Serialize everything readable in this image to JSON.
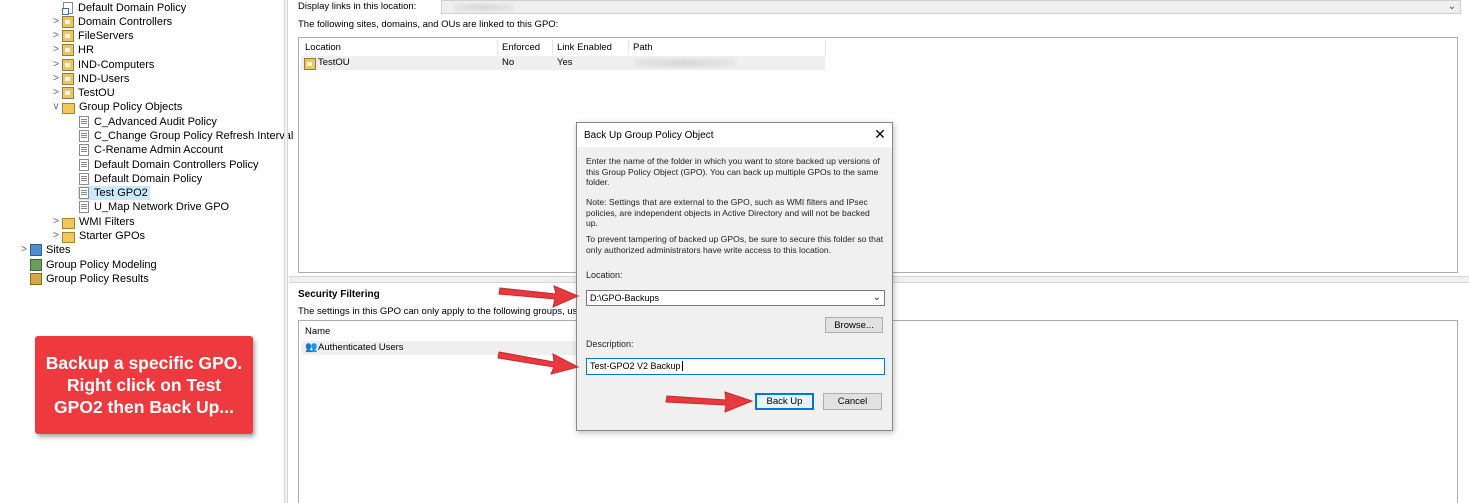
{
  "tree": {
    "items": [
      {
        "label": "Default Domain Policy",
        "icon": "linked-gpo-icon",
        "chevron": ""
      },
      {
        "label": "Domain Controllers",
        "icon": "ou-icon",
        "chevron": ">"
      },
      {
        "label": "FileServers",
        "icon": "ou-icon",
        "chevron": ">"
      },
      {
        "label": "HR",
        "icon": "ou-icon",
        "chevron": ">"
      },
      {
        "label": "IND-Computers",
        "icon": "ou-icon",
        "chevron": ">"
      },
      {
        "label": "IND-Users",
        "icon": "ou-icon",
        "chevron": ">"
      },
      {
        "label": "TestOU",
        "icon": "ou-icon",
        "chevron": ">"
      },
      {
        "label": "Group Policy Objects",
        "icon": "folder-icon",
        "chevron": "v"
      },
      {
        "label": "C_Advanced Audit Policy",
        "icon": "gpo-icon",
        "chevron": ""
      },
      {
        "label": "C_Change Group Policy Refresh Interval",
        "icon": "gpo-icon",
        "chevron": ""
      },
      {
        "label": "C-Rename Admin Account",
        "icon": "gpo-icon",
        "chevron": ""
      },
      {
        "label": "Default Domain Controllers Policy",
        "icon": "gpo-icon",
        "chevron": ""
      },
      {
        "label": "Default Domain Policy",
        "icon": "gpo-icon",
        "chevron": ""
      },
      {
        "label": "Test GPO2",
        "icon": "gpo-icon",
        "chevron": "",
        "selected": true
      },
      {
        "label": "U_Map Network Drive GPO",
        "icon": "gpo-icon",
        "chevron": ""
      },
      {
        "label": "WMI Filters",
        "icon": "folder-icon",
        "chevron": ">"
      },
      {
        "label": "Starter GPOs",
        "icon": "folder-icon",
        "chevron": ">"
      },
      {
        "label": "Sites",
        "icon": "sites-icon",
        "chevron": ">"
      },
      {
        "label": "Group Policy Modeling",
        "icon": "modeling-icon",
        "chevron": ""
      },
      {
        "label": "Group Policy Results",
        "icon": "results-icon",
        "chevron": ""
      }
    ]
  },
  "callout": {
    "text": "Backup a specific GPO. Right click on Test GPO2 then Back Up..."
  },
  "scope": {
    "display_links_label": "Display links in this location:",
    "linked_label": "The following sites, domains, and OUs are linked to this GPO:",
    "columns": [
      "Location",
      "Enforced",
      "Link Enabled",
      "Path"
    ],
    "rows": [
      {
        "location": "TestOU",
        "enforced": "No",
        "link_enabled": "Yes"
      }
    ]
  },
  "security": {
    "heading": "Security Filtering",
    "desc": "The settings in this GPO can only apply to the following groups, users, and c",
    "column": "Name",
    "rows": [
      "Authenticated Users"
    ]
  },
  "dialog": {
    "title": "Back Up Group Policy Object",
    "para1": "Enter the name of the folder in which you want to store backed up versions of this Group Policy Object (GPO). You can back up multiple GPOs to the same folder.",
    "para2": "Note: Settings that are external to the GPO, such as WMI filters and IPsec policies, are independent objects in Active Directory and will not be backed up.",
    "para3": "To prevent tampering of backed up GPOs, be sure to secure this folder so that only authorized administrators have write access to this location.",
    "location_label": "Location:",
    "location_value": "D:\\GPO-Backups",
    "browse_label": "Browse...",
    "description_label": "Description:",
    "description_value": "Test-GPO2 V2 Backup",
    "backup_label": "Back Up",
    "cancel_label": "Cancel"
  },
  "colors": {
    "callout": "#ee3a3f",
    "arrow": "#e8393e",
    "selection": "#cce8ff",
    "focus": "#0078d7"
  }
}
